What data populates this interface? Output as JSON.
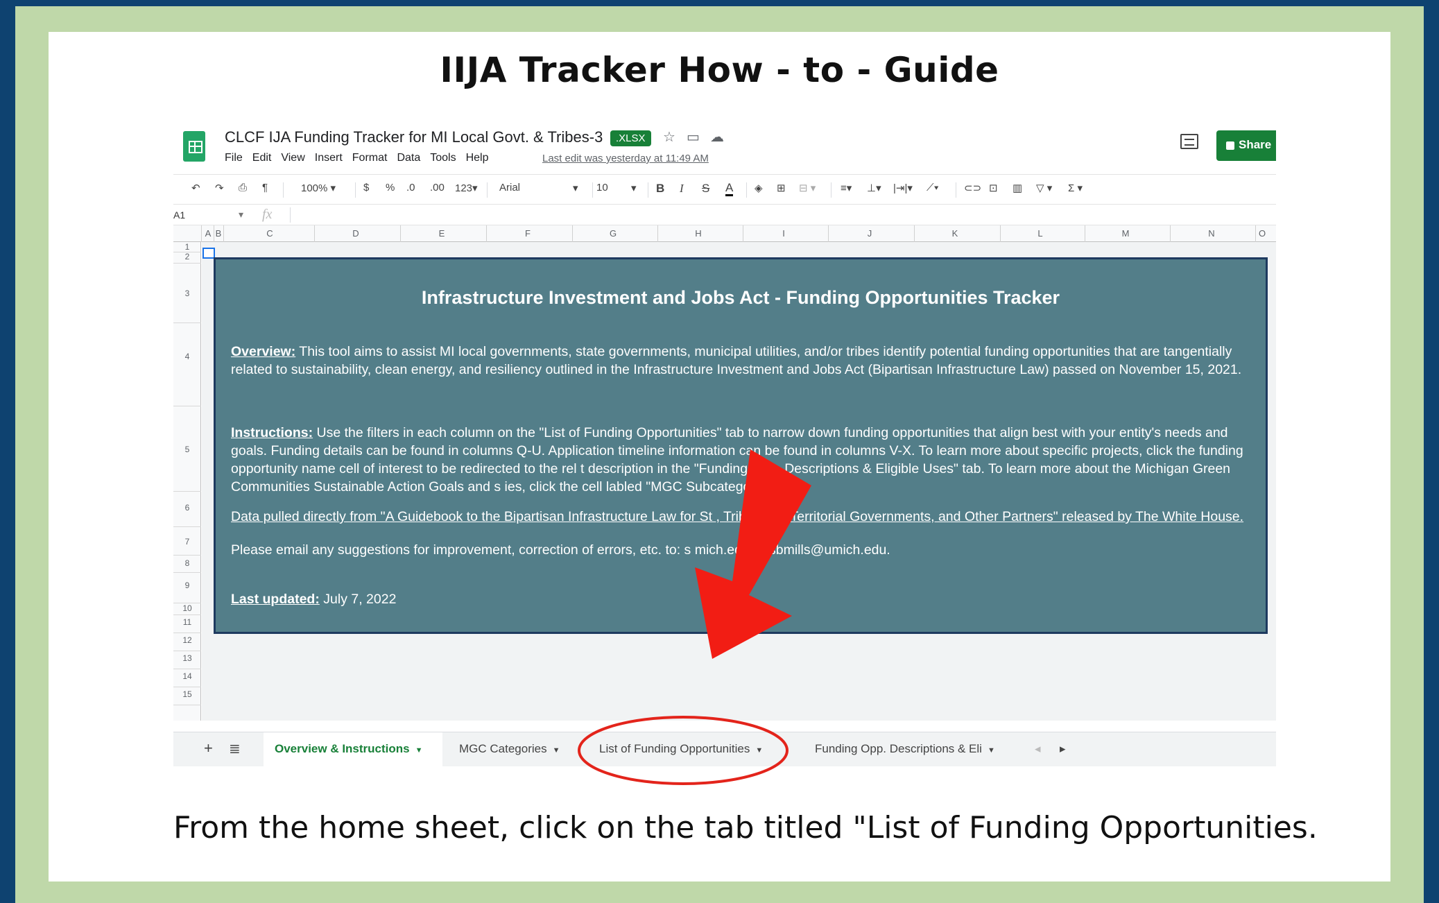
{
  "guide_title": "IIJA Tracker How - to - Guide",
  "spreadsheet": {
    "doc_title": "CLCF IJA Funding Tracker for MI Local Govt. & Tribes-3",
    "badge": ".XLSX",
    "menu": [
      "File",
      "Edit",
      "View",
      "Insert",
      "Format",
      "Data",
      "Tools",
      "Help"
    ],
    "last_edit": "Last edit was yesterday at 11:49 AM",
    "share_label": "Share",
    "toolbar": {
      "zoom": "100%",
      "currency": "$",
      "percent": "%",
      "dec_decrease": ".0",
      "dec_increase": ".00",
      "number_format": "123",
      "font": "Arial",
      "font_size": "10",
      "bold": "B",
      "italic": "I",
      "strike": "S",
      "text_color": "A"
    },
    "name_box": "A1",
    "fx": "fx",
    "columns": [
      "A",
      "B",
      "C",
      "D",
      "E",
      "F",
      "G",
      "H",
      "I",
      "J",
      "K",
      "L",
      "M",
      "N",
      "O"
    ],
    "rows": [
      "1",
      "2",
      "3",
      "4",
      "5",
      "6",
      "7",
      "8",
      "9",
      "10",
      "11",
      "12",
      "13",
      "14",
      "15"
    ],
    "panel": {
      "title": "Infrastructure Investment and Jobs Act - Funding Opportunities Tracker",
      "overview_label": "Overview:",
      "overview_text": " This tool aims to assist MI local governments, state governments, municipal utilities, and/or tribes identify potential funding opportunities that are tangentially related to sustainability, clean energy, and resiliency outlined in the Infrastructure Investment and Jobs Act (Bipartisan Infrastructure Law) passed on November 15, 2021.",
      "instructions_label": "Instructions:",
      "instructions_text": " Use the filters in each column on the \"List of Funding Opportunities\" tab to narrow down funding opportunities that align best with your entity's needs and goals. Funding details can be found in columns Q-U. Application timeline information can be found in columns V-X. To learn more about specific projects, click the funding opportunity name cell of interest to be redirected to the rel      t description in the \"Funding Opp. Descriptions & Eligible Uses\" tab. To learn more about the Michigan Green Communities Sustainable Action Goals and s          ies, click the cell labled \"MGC Subcategories\".",
      "source_text": "Data pulled directly from \"A Guidebook to the Bipartisan Infrastructure Law for St            , Tribal, and Territorial Governments, and Other Partners\" released by The White House.",
      "email_text": "Please email any suggestions for improvement, correction of errors, etc. to: s            mich.edu or sbmills@umich.edu.",
      "updated_label": "Last updated:",
      "updated_text": " July 7, 2022"
    },
    "tabs": [
      {
        "label": "Overview & Instructions"
      },
      {
        "label": "MGC Categories"
      },
      {
        "label": "List of Funding Opportunities"
      },
      {
        "label": "Funding Opp. Descriptions & Eli"
      }
    ]
  },
  "caption": "From the home sheet, click on the tab titled \"List of Funding Opportunities.",
  "colors": {
    "background": "#0e4270",
    "frame": "#bfd8a9",
    "panel": "#537e89",
    "sheets_green": "#188038",
    "arrow": "#f21d14",
    "highlight_circle": "#e3241b"
  }
}
